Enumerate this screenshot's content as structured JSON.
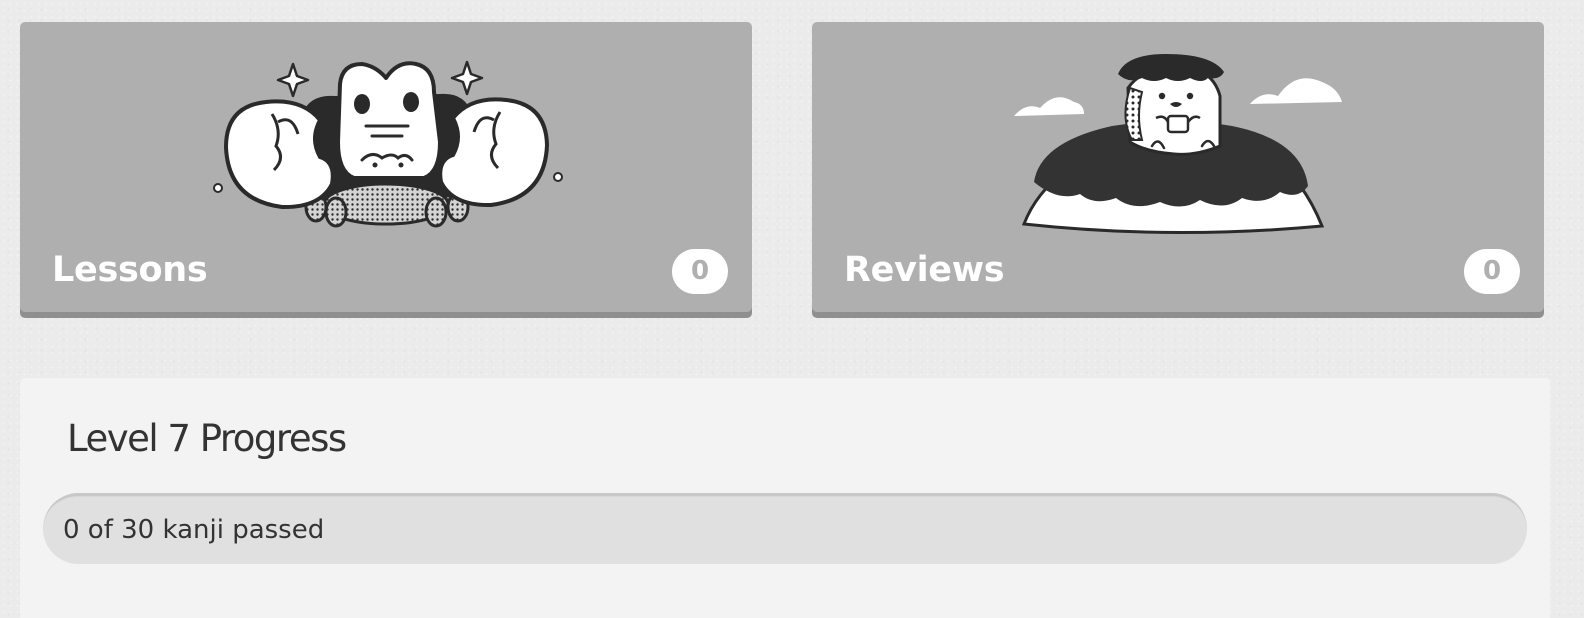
{
  "cards": {
    "lessons": {
      "title": "Lessons",
      "count": "0",
      "illustration": "crabigator-mascot"
    },
    "reviews": {
      "title": "Reviews",
      "count": "0",
      "illustration": "mascot-on-hill-with-clouds"
    }
  },
  "progress": {
    "title": "Level 7 Progress",
    "status_text": "0 of 30 kanji passed",
    "passed": 0,
    "total": 30
  },
  "colors": {
    "card_background": "#afafaf",
    "card_shadow": "#8f8f8f",
    "card_text": "#ffffff",
    "page_background": "#ebebeb",
    "panel_background": "#f3f3f3",
    "progress_track": "#e0e0e0",
    "text_dark": "#333333"
  }
}
